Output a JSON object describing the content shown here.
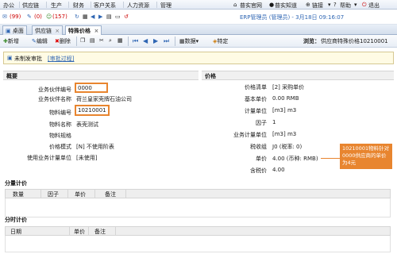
{
  "menu": {
    "left_items": [
      "办公",
      "供应链",
      "生产",
      "财务",
      "客户关系",
      "人力资源",
      "管理"
    ],
    "right_items": [
      "普实官网",
      "普实知道",
      "链接",
      "帮助",
      "退出"
    ]
  },
  "toolbar1": {
    "mail_count": "(99)",
    "count2": "(0)",
    "count3": "(157)",
    "user_info": "ERP管理员 (管理员) - 3月18日 09:16:07"
  },
  "tabs": [
    {
      "label": "桌面"
    },
    {
      "label": "供应链"
    },
    {
      "label": "特殊价格"
    }
  ],
  "actions": {
    "new": "新增",
    "edit": "编辑",
    "delete": "删除",
    "data": "数据",
    "special": "特定",
    "browse_label": "浏览：",
    "browse_value": "供应商特殊价格10210001"
  },
  "status": {
    "text": "未制发审批",
    "link": "[审批过程]"
  },
  "summary": {
    "title": "概要",
    "fields": [
      {
        "label": "业务伙伴编号",
        "value": "0000"
      },
      {
        "label": "业务伙伴名称",
        "value": "荷兰皇家壳牌石油公司"
      },
      {
        "label": "物料编号",
        "value": "10210001"
      },
      {
        "label": "物料名称",
        "value": "表壳测试"
      },
      {
        "label": "物料规格",
        "value": ""
      },
      {
        "label": "价格模式",
        "value": "[N] 不使用阶表"
      },
      {
        "label": "使用业务计量单位",
        "value": "[未使用]"
      }
    ]
  },
  "price": {
    "title": "价格",
    "fields": [
      {
        "label": "价格清单",
        "value": "[2] 采购单价"
      },
      {
        "label": "基本单价",
        "value": "0.00 RMB"
      },
      {
        "label": "计量单位",
        "value": "[m3] m3"
      },
      {
        "label": "因子",
        "value": "1"
      },
      {
        "label": "业务计量单位",
        "value": "[m3] m3"
      },
      {
        "label": "税收组",
        "value": "J0 (税率: 0)"
      },
      {
        "label": "单价",
        "value": "4.00 (币种: RMB)"
      },
      {
        "label": "含税价",
        "value": "4.00"
      }
    ]
  },
  "callout": "10210001物料针对0000供应商的单价为4元",
  "tiered": {
    "title": "分量计价",
    "headers": [
      "数量",
      "因子",
      "单价",
      "备注"
    ]
  },
  "timed": {
    "title": "分时计价",
    "headers": [
      "日期",
      "单价",
      "备注"
    ]
  }
}
